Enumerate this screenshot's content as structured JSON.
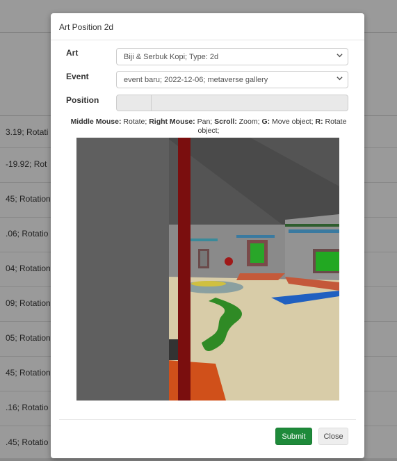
{
  "background_rows": [
    "3.19; Rotati",
    "-19.92; Rot",
    "45; Rotation",
    ".06; Rotatio",
    "04; Rotation",
    "09; Rotation",
    "05; Rotation:",
    "45; Rotation",
    ".16; Rotatio",
    ".45; Rotatio"
  ],
  "modal": {
    "title": "Art Position 2d",
    "art": {
      "label": "Art",
      "value": "Biji & Serbuk Kopi; Type: 2d"
    },
    "event": {
      "label": "Event",
      "value": "event baru; 2022-12-06; metaverse gallery"
    },
    "position": {
      "label": "Position",
      "value_1": "",
      "value_2": ""
    },
    "help": {
      "middle_key": "Middle Mouse:",
      "middle_action": "Rotate;",
      "right_key": "Right Mouse:",
      "right_action": "Pan;",
      "scroll_key": "Scroll:",
      "scroll_action": "Zoom;",
      "g_key": "G:",
      "g_action": "Move object;",
      "r_key": "R:",
      "r_action": "Rotate object;"
    },
    "submit_label": "Submit",
    "close_label": "Close"
  },
  "icons": {
    "select_arrow": "chevron-down-icon"
  },
  "colors": {
    "submit": "#1e8a3a",
    "viewport_floor": "#d8cca8",
    "path": "#2f8a25",
    "red_pole": "#7a0e0e"
  }
}
